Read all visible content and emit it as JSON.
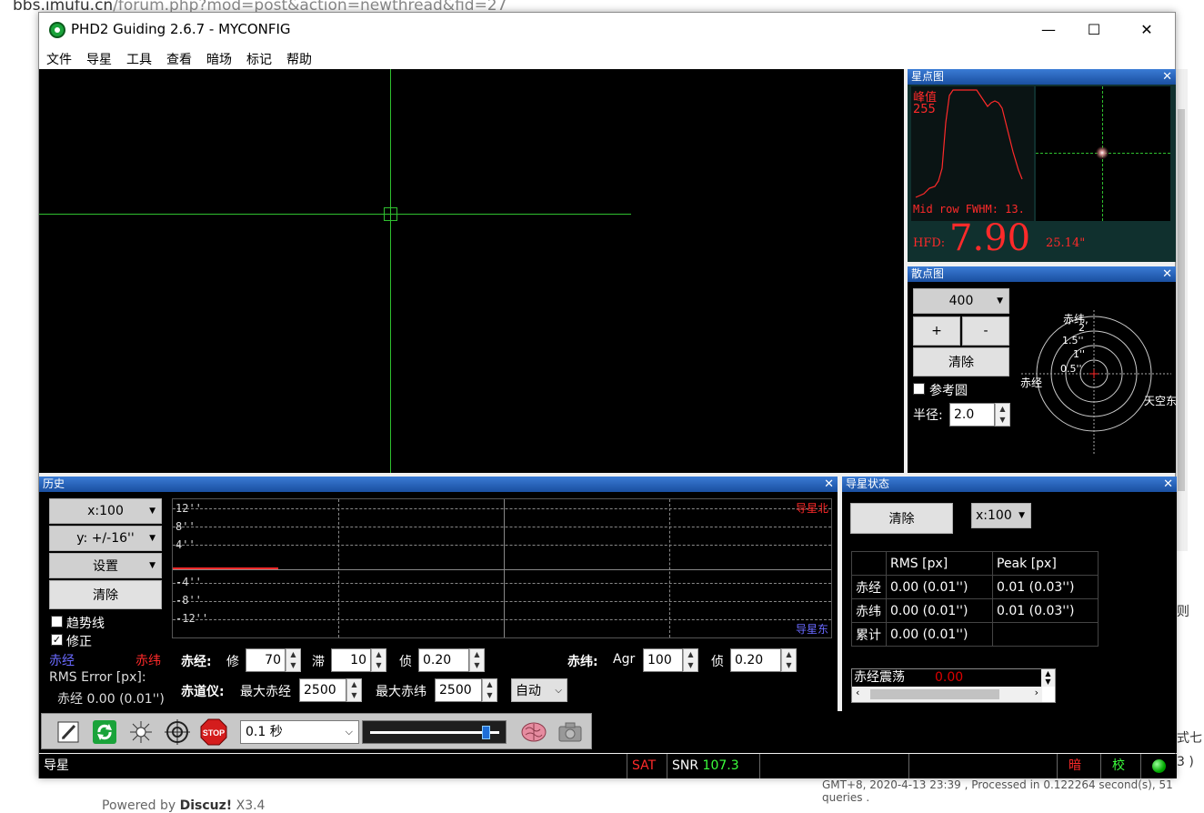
{
  "browser": {
    "url_host": "bbs.imufu.cn",
    "url_path": "/forum.php?mod=post&action=newthread&fid=27",
    "footer": "GMT+8, 2020-4-13 23:39 , Processed in 0.122264 second(s), 51 queries .",
    "powered_prefix": "Powered by ",
    "powered_brand": "Discuz!",
    "powered_version": " X3.4",
    "right_fragment_1": "则",
    "right_fragment_2": "式七",
    "right_fragment_3": "3 )"
  },
  "window": {
    "title": "PHD2 Guiding 2.6.7 - MYCONFIG",
    "minimize": "—",
    "maximize": "☐",
    "close": "✕"
  },
  "menu": [
    "文件",
    "导星",
    "工具",
    "查看",
    "暗场",
    "标记",
    "帮助"
  ],
  "star_profile": {
    "title": "星点图",
    "peak_label": "峰值",
    "peak_value": "255",
    "fwhm_label": "Mid row FWHM: 13.",
    "hfd_label": "HFD:",
    "hfd_value": "7.90",
    "hfd_arcsec": "25.14\""
  },
  "scatter": {
    "title": "散点图",
    "scale_value": "400",
    "plus": "+",
    "minus": "-",
    "clear": "清除",
    "ref_circle": "参考圆",
    "radius_label": "半径:",
    "radius_value": "2.0",
    "dec_label": "赤纬,",
    "ring_labels": [
      "2",
      "1.5''",
      "1''",
      "0.5''"
    ],
    "ra_label": "赤经",
    "sky_label": "天空东"
  },
  "history": {
    "title": "历史",
    "x_scale": "x:100",
    "y_scale": "y: +/-16''",
    "settings": "设置",
    "clear": "清除",
    "trend": "趋势线",
    "correction": "修正",
    "ra_legend": "赤经",
    "dec_legend": "赤纬",
    "rms_title": "RMS Error [px]:",
    "rms_ra": "赤经 0.00 (0.01'')",
    "y_labels": [
      "12''",
      "8''",
      "4''",
      "-4''",
      "-8''",
      "-12''"
    ],
    "north_label": "导星北",
    "east_label": "导星东",
    "ra_section": "赤经:",
    "ra_agg_label": "修",
    "ra_agg": "70",
    "ra_hyst_label": "滞",
    "ra_hyst": "10",
    "ra_min_label": "侦",
    "ra_min": "0.20",
    "dec_section": "赤纬:",
    "dec_agg_label": "Agr",
    "dec_agg": "100",
    "dec_min_label": "侦",
    "dec_min": "0.20",
    "mount_section": "赤道仪:",
    "max_ra_label": "最大赤经",
    "max_ra": "2500",
    "max_dec_label": "最大赤纬",
    "max_dec": "2500",
    "dec_mode": "自动"
  },
  "guide_state": {
    "title": "导星状态",
    "clear": "清除",
    "x_scale": "x:100",
    "headers": [
      "",
      "RMS [px]",
      "Peak [px]"
    ],
    "rows": [
      [
        "赤经",
        "0.00 (0.01'')",
        "0.01 (0.03'')"
      ],
      [
        "赤纬",
        "0.00 (0.01'')",
        "0.01 (0.03'')"
      ],
      [
        "累计",
        "0.00 (0.01'')",
        ""
      ]
    ],
    "osc_label": "赤经震荡",
    "osc_value": "0.00"
  },
  "toolbar": {
    "exposure": "0.1 秒"
  },
  "status": {
    "mode": "导星",
    "sat": "SAT",
    "snr_label": "SNR",
    "snr_value": "107.3",
    "dark": "暗",
    "cal": "校"
  },
  "colors": {
    "crosshair": "#2fbf2f",
    "profile_red": "#ff2a2a",
    "ra_blue": "#6a6aff",
    "dec_red": "#ff2a2a",
    "snr_green": "#3cff3c"
  }
}
